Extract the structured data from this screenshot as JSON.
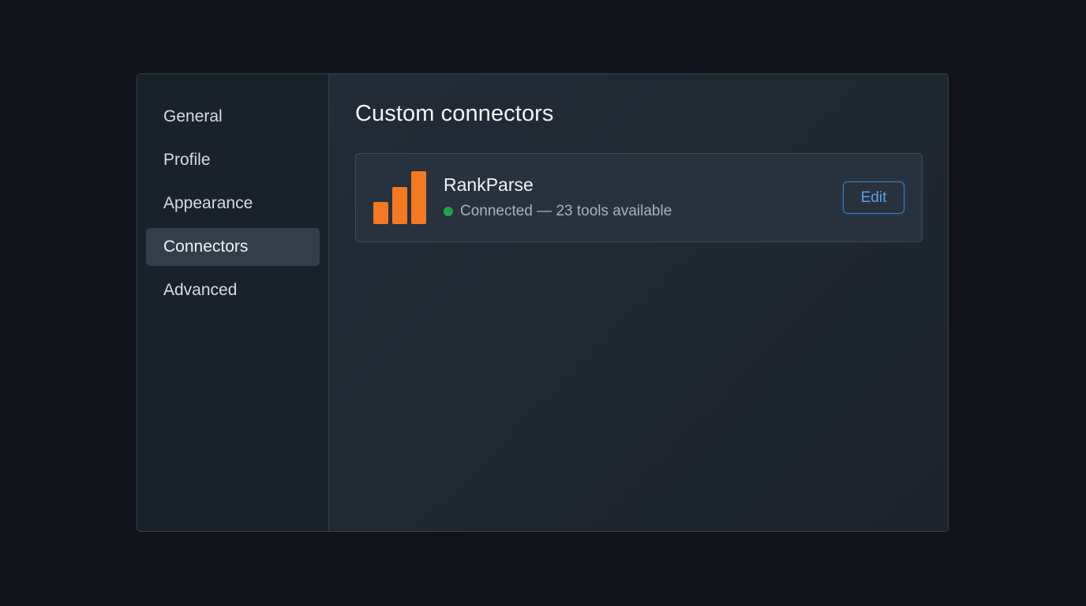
{
  "sidebar": {
    "items": [
      {
        "label": "General",
        "active": false
      },
      {
        "label": "Profile",
        "active": false
      },
      {
        "label": "Appearance",
        "active": false
      },
      {
        "label": "Connectors",
        "active": true
      },
      {
        "label": "Advanced",
        "active": false
      }
    ]
  },
  "main": {
    "title": "Custom connectors",
    "connectors": [
      {
        "name": "RankParse",
        "status_text": "Connected — 23 tools available",
        "status_color": "#22a34a",
        "logo_icon": "bar-chart-icon",
        "logo_color": "#f47920",
        "edit_label": "Edit"
      }
    ]
  },
  "colors": {
    "accent": "#3b82c4",
    "background": "#11151b"
  }
}
